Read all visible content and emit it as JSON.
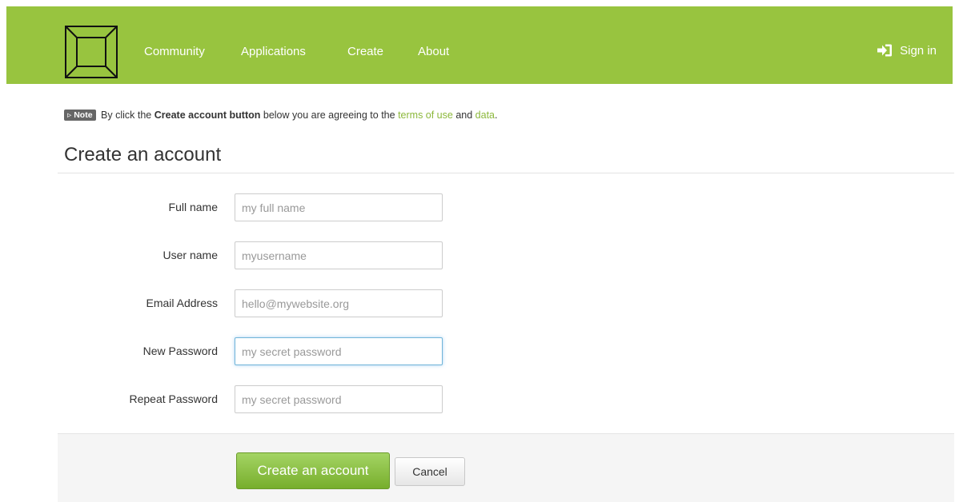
{
  "navbar": {
    "items": [
      {
        "label": "Community"
      },
      {
        "label": "Applications"
      },
      {
        "label": "Create"
      },
      {
        "label": "About"
      }
    ],
    "signin_label": "Sign in"
  },
  "note": {
    "badge": "Note",
    "text_1": "By click the",
    "bold": "Create account button",
    "text_2": "below you are agreeing to the",
    "terms_link": "terms of use",
    "and_text": "and",
    "data_link": "data",
    "period": "."
  },
  "page_title": "Create an account",
  "form": {
    "fields": [
      {
        "label": "Full name",
        "placeholder": "my full name"
      },
      {
        "label": "User name",
        "placeholder": "myusername"
      },
      {
        "label": "Email Address",
        "placeholder": "hello@mywebsite.org"
      },
      {
        "label": "New Password",
        "placeholder": "my secret password",
        "focused": true
      },
      {
        "label": "Repeat Password",
        "placeholder": "my secret password"
      }
    ],
    "submit_label": "Create an account",
    "cancel_label": "Cancel"
  },
  "colors": {
    "navbar_bg": "#98c43f",
    "link": "#8cb83b",
    "primary_button": "#8cc14c"
  },
  "icons": {
    "logo": "square-frame-logo",
    "signin": "sign-in-icon"
  }
}
